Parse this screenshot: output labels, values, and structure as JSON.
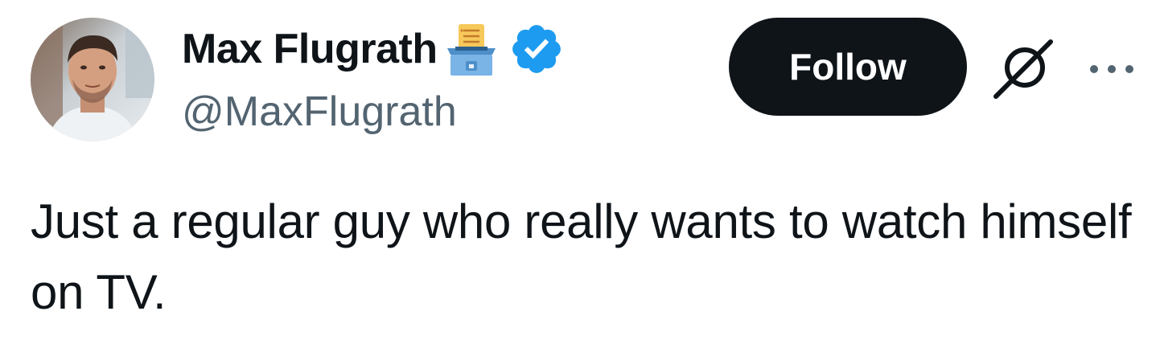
{
  "author": {
    "display_name": "Max Flugrath",
    "handle": "@MaxFlugrath",
    "avatar_icon": "profile-photo",
    "badge_icon": "ballot-box-emoji",
    "verified_icon": "verified-badge-icon",
    "verified_color": "#1d9bf0"
  },
  "actions": {
    "follow_label": "Follow",
    "grok_icon": "grok-icon",
    "more_icon": "more-options-icon"
  },
  "tweet": {
    "text": "Just a regular guy who really wants to watch himself on TV."
  },
  "colors": {
    "text_primary": "#0f1419",
    "text_secondary": "#536471",
    "button_bg": "#0f1419",
    "button_text": "#ffffff",
    "background": "#ffffff"
  }
}
